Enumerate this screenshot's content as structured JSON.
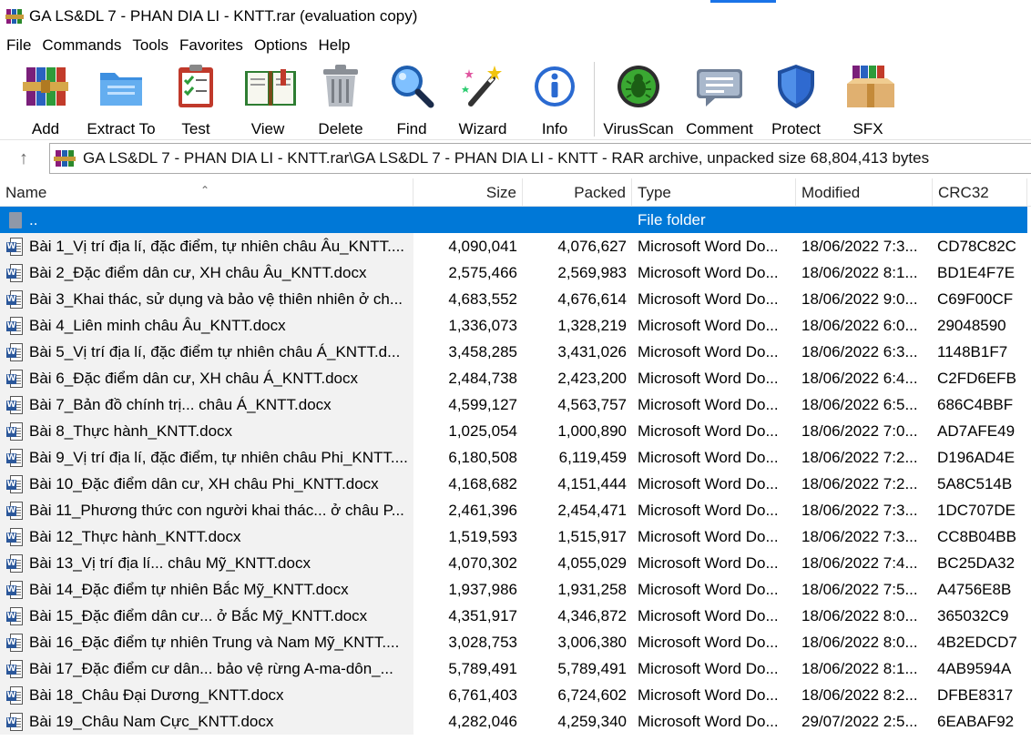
{
  "window": {
    "title": "GA LS&DL 7 - PHAN DIA LI - KNTT.rar (evaluation copy)"
  },
  "menu": [
    "File",
    "Commands",
    "Tools",
    "Favorites",
    "Options",
    "Help"
  ],
  "toolbar": {
    "add": "Add",
    "extract": "Extract To",
    "test": "Test",
    "view": "View",
    "delete": "Delete",
    "find": "Find",
    "wizard": "Wizard",
    "info": "Info",
    "virusscan": "VirusScan",
    "comment": "Comment",
    "protect": "Protect",
    "sfx": "SFX"
  },
  "address": {
    "path": "GA LS&DL 7 - PHAN DIA LI - KNTT.rar\\GA LS&DL 7 - PHAN DIA LI - KNTT - RAR archive, unpacked size 68,804,413 bytes"
  },
  "columns": {
    "name": "Name",
    "size": "Size",
    "packed": "Packed",
    "type": "Type",
    "modified": "Modified",
    "crc": "CRC32"
  },
  "parent_row": {
    "name": "..",
    "type": "File folder"
  },
  "files": [
    {
      "name": "Bài 1_Vị trí địa lí, đặc điểm, tự nhiên châu Âu_KNTT....",
      "size": "4,090,041",
      "packed": "4,076,627",
      "type": "Microsoft Word Do...",
      "modified": "18/06/2022 7:3...",
      "crc": "CD78C82C"
    },
    {
      "name": "Bài 2_Đặc điểm dân cư, XH châu Âu_KNTT.docx",
      "size": "2,575,466",
      "packed": "2,569,983",
      "type": "Microsoft Word Do...",
      "modified": "18/06/2022 8:1...",
      "crc": "BD1E4F7E"
    },
    {
      "name": "Bài 3_Khai thác, sử dụng và bảo vệ thiên nhiên ở ch...",
      "size": "4,683,552",
      "packed": "4,676,614",
      "type": "Microsoft Word Do...",
      "modified": "18/06/2022 9:0...",
      "crc": "C69F00CF"
    },
    {
      "name": "Bài 4_Liên minh châu Âu_KNTT.docx",
      "size": "1,336,073",
      "packed": "1,328,219",
      "type": "Microsoft Word Do...",
      "modified": "18/06/2022 6:0...",
      "crc": "29048590"
    },
    {
      "name": "Bài 5_Vị trí địa lí, đặc điểm tự nhiên châu Á_KNTT.d...",
      "size": "3,458,285",
      "packed": "3,431,026",
      "type": "Microsoft Word Do...",
      "modified": "18/06/2022 6:3...",
      "crc": "1148B1F7"
    },
    {
      "name": "Bài 6_Đặc điểm dân cư, XH châu Á_KNTT.docx",
      "size": "2,484,738",
      "packed": "2,423,200",
      "type": "Microsoft Word Do...",
      "modified": "18/06/2022 6:4...",
      "crc": "C2FD6EFB"
    },
    {
      "name": "Bài 7_Bản đồ chính trị... châu Á_KNTT.docx",
      "size": "4,599,127",
      "packed": "4,563,757",
      "type": "Microsoft Word Do...",
      "modified": "18/06/2022 6:5...",
      "crc": "686C4BBF"
    },
    {
      "name": "Bài 8_Thực hành_KNTT.docx",
      "size": "1,025,054",
      "packed": "1,000,890",
      "type": "Microsoft Word Do...",
      "modified": "18/06/2022 7:0...",
      "crc": "AD7AFE49"
    },
    {
      "name": "Bài 9_Vị trí địa lí, đặc điểm, tự nhiên châu Phi_KNTT....",
      "size": "6,180,508",
      "packed": "6,119,459",
      "type": "Microsoft Word Do...",
      "modified": "18/06/2022 7:2...",
      "crc": "D196AD4E"
    },
    {
      "name": "Bài 10_Đặc điểm dân cư, XH châu Phi_KNTT.docx",
      "size": "4,168,682",
      "packed": "4,151,444",
      "type": "Microsoft Word Do...",
      "modified": "18/06/2022 7:2...",
      "crc": "5A8C514B"
    },
    {
      "name": "Bài 11_Phương thức con người khai thác... ở châu P...",
      "size": "2,461,396",
      "packed": "2,454,471",
      "type": "Microsoft Word Do...",
      "modified": "18/06/2022 7:3...",
      "crc": "1DC707DE"
    },
    {
      "name": "Bài 12_Thực hành_KNTT.docx",
      "size": "1,519,593",
      "packed": "1,515,917",
      "type": "Microsoft Word Do...",
      "modified": "18/06/2022 7:3...",
      "crc": "CC8B04BB"
    },
    {
      "name": "Bài 13_Vị trí địa lí... châu Mỹ_KNTT.docx",
      "size": "4,070,302",
      "packed": "4,055,029",
      "type": "Microsoft Word Do...",
      "modified": "18/06/2022 7:4...",
      "crc": "BC25DA32"
    },
    {
      "name": "Bài 14_Đặc điểm tự nhiên Bắc Mỹ_KNTT.docx",
      "size": "1,937,986",
      "packed": "1,931,258",
      "type": "Microsoft Word Do...",
      "modified": "18/06/2022 7:5...",
      "crc": "A4756E8B"
    },
    {
      "name": "Bài 15_Đặc điểm dân cư... ở Bắc Mỹ_KNTT.docx",
      "size": "4,351,917",
      "packed": "4,346,872",
      "type": "Microsoft Word Do...",
      "modified": "18/06/2022 8:0...",
      "crc": "365032C9"
    },
    {
      "name": "Bài 16_Đặc điểm tự nhiên Trung và Nam Mỹ_KNTT....",
      "size": "3,028,753",
      "packed": "3,006,380",
      "type": "Microsoft Word Do...",
      "modified": "18/06/2022 8:0...",
      "crc": "4B2EDCD7"
    },
    {
      "name": "Bài 17_Đặc điểm cư dân... bảo vệ rừng A-ma-dôn_...",
      "size": "5,789,491",
      "packed": "5,789,491",
      "type": "Microsoft Word Do...",
      "modified": "18/06/2022 8:1...",
      "crc": "4AB9594A"
    },
    {
      "name": "Bài 18_Châu Đại Dương_KNTT.docx",
      "size": "6,761,403",
      "packed": "6,724,602",
      "type": "Microsoft Word Do...",
      "modified": "18/06/2022 8:2...",
      "crc": "DFBE8317"
    },
    {
      "name": "Bài 19_Châu Nam Cực_KNTT.docx",
      "size": "4,282,046",
      "packed": "4,259,340",
      "type": "Microsoft Word Do...",
      "modified": "29/07/2022 2:5...",
      "crc": "6EABAF92"
    }
  ],
  "icons": {
    "app": "winrar-books-icon",
    "file": "word-document-icon",
    "folder": "folder-icon"
  }
}
